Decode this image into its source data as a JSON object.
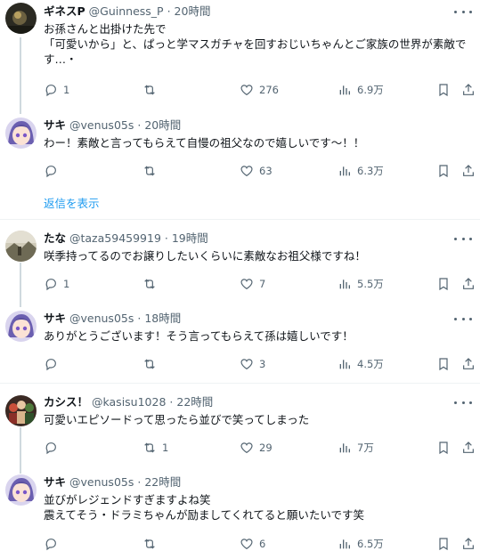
{
  "posts": [
    {
      "display_name": "ギネスP",
      "handle": "@Guinness_P",
      "separator": "·",
      "time": "20時間",
      "text": "お孫さんと出掛けた先で\n「可愛いから」と、ぱっと学マスガチャを回すおじいちゃんとご家族の世界が素敵です…・",
      "replies": "1",
      "retweets": "",
      "likes": "276",
      "views": "6.9万",
      "avatar": "dark-photo"
    },
    {
      "display_name": "サキ",
      "handle": "@venus05s",
      "separator": "·",
      "time": "20時間",
      "text": "わー！素敵と言ってもらえて自慢の祖父なので嬉しいです～！！",
      "replies": "",
      "retweets": "",
      "likes": "63",
      "views": "6.3万",
      "avatar": "anime-girl"
    },
    {
      "display_name": "たな",
      "handle": "@taza59459919",
      "separator": "·",
      "time": "19時間",
      "text": "咲季持ってるのでお譲りしたいくらいに素敵なお祖父様ですね！",
      "replies": "1",
      "retweets": "",
      "likes": "7",
      "views": "5.5万",
      "avatar": "landscape-photo"
    },
    {
      "display_name": "サキ",
      "handle": "@venus05s",
      "separator": "·",
      "time": "18時間",
      "text": "ありがとうございます！そう言ってもらえて孫は嬉しいです！",
      "replies": "",
      "retweets": "",
      "likes": "3",
      "views": "4.5万",
      "avatar": "anime-girl"
    },
    {
      "display_name": "カシス！",
      "handle": "@kasisu1028",
      "separator": "·",
      "time": "22時間",
      "text": "可愛いエピソードって思ったら並びで笑ってしまった",
      "replies": "",
      "retweets": "1",
      "likes": "29",
      "views": "7万",
      "avatar": "figures-photo"
    },
    {
      "display_name": "サキ",
      "handle": "@venus05s",
      "separator": "·",
      "time": "22時間",
      "text": "並びがレジェンドすぎますよね笑\n震えてそう・ドラミちゃんが励ましてくれてると願いたいです笑",
      "replies": "",
      "retweets": "",
      "likes": "6",
      "views": "6.5万",
      "avatar": "anime-girl"
    }
  ],
  "show_replies_label": "返信を表示",
  "colors": {
    "link": "#1d9bf0",
    "muted": "#536471",
    "text": "#0f1419",
    "divider": "#eff3f4"
  }
}
